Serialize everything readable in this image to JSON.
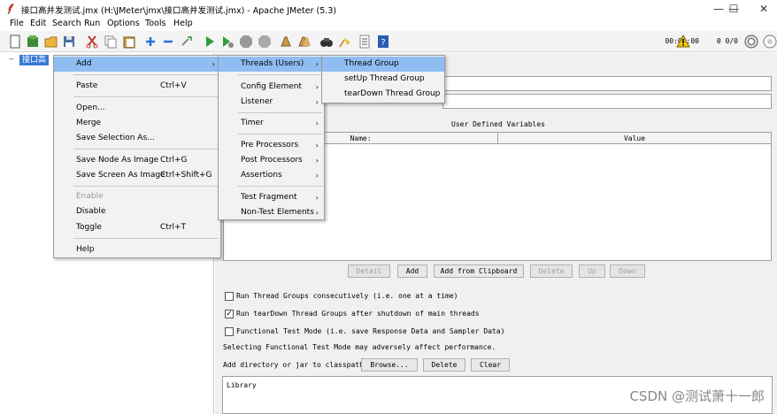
{
  "window": {
    "title": "接口高并发测试.jmx (H:\\JMeter\\jmx\\接口高并发测试.jmx) - Apache JMeter (5.3)",
    "minimize": "—",
    "maximize": "☐",
    "close": "✕"
  },
  "menubar": [
    "File",
    "Edit",
    "Search",
    "Run",
    "Options",
    "Tools",
    "Help"
  ],
  "toolbar": {
    "timer": "00:00:00",
    "warn_count": "0  0/0"
  },
  "tree": {
    "root_label": "接口高"
  },
  "context_menu": {
    "items": [
      {
        "label": "Add",
        "shortcut": "",
        "submenu": true,
        "highlighted": true
      },
      {
        "label": "Paste",
        "shortcut": "Ctrl+V"
      },
      {
        "label": "Open..."
      },
      {
        "label": "Merge"
      },
      {
        "label": "Save Selection As..."
      },
      {
        "label": "Save Node As Image",
        "shortcut": "Ctrl+G"
      },
      {
        "label": "Save Screen As Image",
        "shortcut": "Ctrl+Shift+G"
      },
      {
        "label": "Enable",
        "disabled": true
      },
      {
        "label": "Disable"
      },
      {
        "label": "Toggle",
        "shortcut": "Ctrl+T"
      },
      {
        "label": "Help"
      }
    ]
  },
  "add_submenu": {
    "items": [
      {
        "label": "Threads (Users)",
        "highlighted": true
      },
      {
        "label": "Config Element"
      },
      {
        "label": "Listener"
      },
      {
        "label": "Timer"
      },
      {
        "label": "Pre Processors"
      },
      {
        "label": "Post Processors"
      },
      {
        "label": "Assertions"
      },
      {
        "label": "Test Fragment"
      },
      {
        "label": "Non-Test Elements"
      }
    ]
  },
  "threads_submenu": {
    "items": [
      {
        "label": "Thread Group",
        "highlighted": true
      },
      {
        "label": "setUp Thread Group"
      },
      {
        "label": "tearDown Thread Group"
      }
    ]
  },
  "test_plan": {
    "udv_title": "User Defined Variables",
    "col_name": "Name:",
    "col_value": "Value",
    "buttons": {
      "detail": "Detail",
      "add": "Add",
      "add_clipboard": "Add from Clipboard",
      "delete": "Delete",
      "up": "Up",
      "down": "Down"
    },
    "options": {
      "run_consecutively": "Run Thread Groups consecutively (i.e. one at a time)",
      "run_consecutively_checked": false,
      "run_teardown": "Run tearDown Thread Groups after shutdown of main threads",
      "run_teardown_checked": true,
      "functional_mode": "Functional Test Mode (i.e. save Response Data and Sampler Data)",
      "functional_mode_checked": false
    },
    "functional_note": "Selecting Functional Test Mode may adversely affect performance.",
    "classpath_label": "Add directory or jar to classpath",
    "browse": "Browse...",
    "delete": "Delete",
    "clear": "Clear",
    "library_header": "Library"
  },
  "watermark": "CSDN @测试萧十一郎"
}
